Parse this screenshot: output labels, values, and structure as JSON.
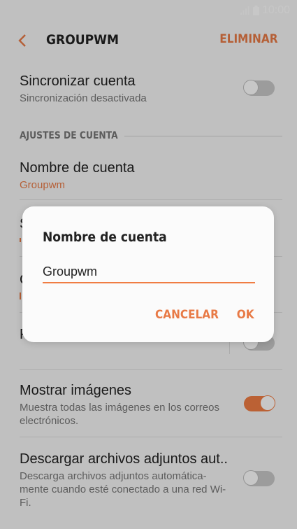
{
  "status_bar": {
    "time": "10:00"
  },
  "header": {
    "title": "GROUPWM",
    "action": "ELIMINAR"
  },
  "settings": {
    "sync": {
      "title": "Sincronizar cuenta",
      "subtitle": "Sincronización desactivada",
      "enabled": false
    },
    "section_label": "AJUSTES DE CUENTA",
    "account_name": {
      "title": "Nombre de cuenta",
      "value": "Groupwm"
    },
    "show_images": {
      "title": "Mostrar imágenes",
      "subtitle": "Muestra todas las imágenes en los correos electrónicos.",
      "enabled": true
    },
    "auto_download": {
      "title": "Descargar archivos adjuntos aut..",
      "subtitle": "Descarga archivos adjuntos automática-mente cuando esté conectado a una red Wi-Fi.",
      "enabled": false
    },
    "partial_rows": [
      {
        "title_fragment": "S"
      },
      {
        "title_fragment": "C"
      },
      {
        "title_fragment": "F"
      }
    ]
  },
  "dialog": {
    "title": "Nombre de cuenta",
    "input_value": "Groupwm",
    "cancel_label": "CANCELAR",
    "ok_label": "OK"
  },
  "colors": {
    "accent": "#f07d43",
    "background": "#f7f7f7",
    "scrim": "rgba(0,0,0,0.22)"
  }
}
